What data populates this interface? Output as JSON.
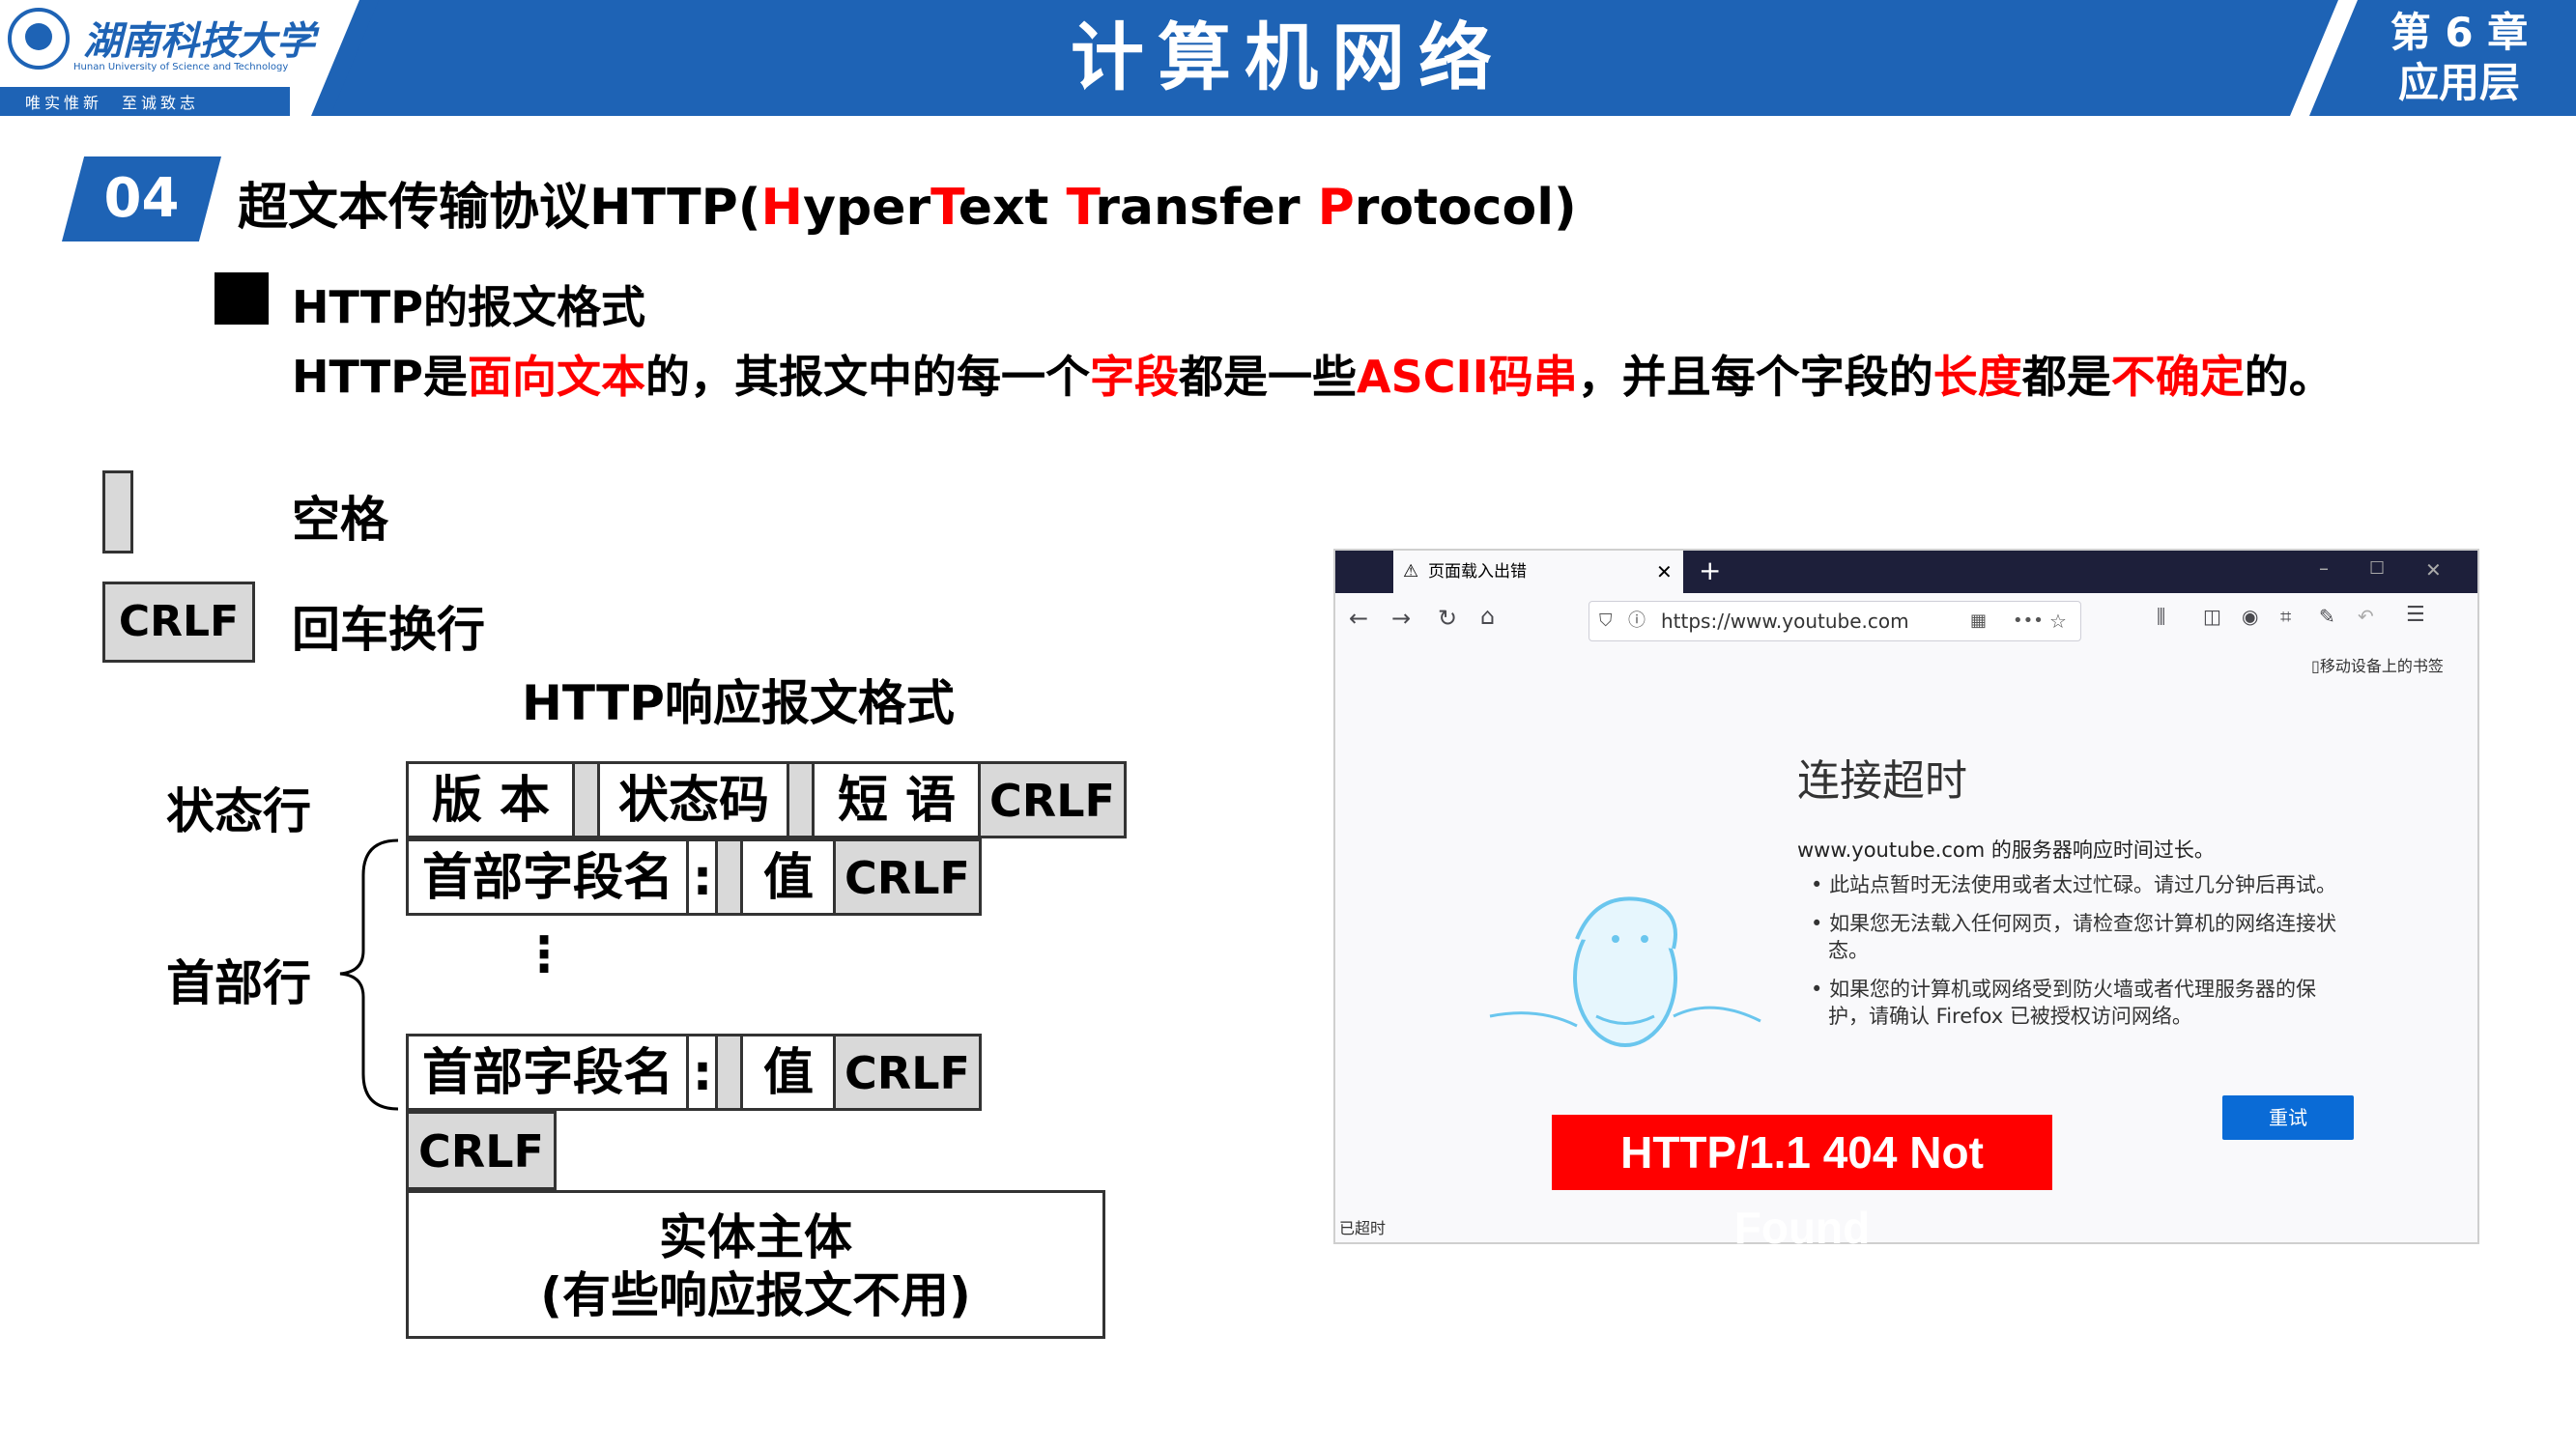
{
  "header": {
    "logo_cn": "湖南科技大学",
    "logo_en": "Hunan University of Science and Technology",
    "motto": "唯实惟新　至诚致志",
    "title": "计算机网络",
    "chapter_line1": "第 6 章",
    "chapter_line2": "应用层"
  },
  "section": {
    "number": "04",
    "title_cn": "超文本传输协议HTTP(",
    "title_en": [
      {
        "text": "H",
        "red": true
      },
      {
        "text": "yper",
        "red": false
      },
      {
        "text": "T",
        "red": true
      },
      {
        "text": "ext ",
        "red": false
      },
      {
        "text": "T",
        "red": true
      },
      {
        "text": "ransfer ",
        "red": false
      },
      {
        "text": "P",
        "red": true
      },
      {
        "text": "rotocol)",
        "red": false
      }
    ]
  },
  "subsection": {
    "title": "HTTP的报文格式",
    "description": [
      {
        "text": "HTTP是",
        "red": false
      },
      {
        "text": "面向文本",
        "red": true
      },
      {
        "text": "的，其报文中的每一个",
        "red": false
      },
      {
        "text": "字段",
        "red": true
      },
      {
        "text": "都是一些",
        "red": false
      },
      {
        "text": "ASCII码串",
        "red": true
      },
      {
        "text": "，并且每个字段的",
        "red": false
      },
      {
        "text": "长度",
        "red": true
      },
      {
        "text": "都是",
        "red": false
      },
      {
        "text": "不确定",
        "red": true
      },
      {
        "text": "的。",
        "red": false
      }
    ]
  },
  "legend": {
    "space_label": "空格",
    "crlf_box": "CRLF",
    "crlf_label": "回车换行"
  },
  "diagram": {
    "title": "HTTP响应报文格式",
    "status_line_label": "状态行",
    "header_line_label": "首部行",
    "version": "版 本",
    "status_code": "状态码",
    "phrase": "短 语",
    "crlf": "CRLF",
    "header_field_name": "首部字段名",
    "colon": ":",
    "value": "值",
    "vdots": "⋮",
    "entity_line1": "实体主体",
    "entity_line2": "(有些响应报文不用)"
  },
  "browser": {
    "tab_title": "页面载入出错",
    "url": "https://www.youtube.com",
    "bookmark_text": "移动设备上的书签",
    "error_title": "连接超时",
    "error_desc": "www.youtube.com 的服务器响应时间过长。",
    "error_items": [
      "此站点暂时无法使用或者太过忙碌。请过几分钟后再试。",
      "如果您无法载入任何网页，请检查您计算机的网络连接状态。",
      "如果您的计算机或网络受到防火墙或者代理服务器的保护，请确认 Firefox 已被授权访问网络。"
    ],
    "retry_button": "重试",
    "status_text": "已超时"
  },
  "overlay_label": "HTTP/1.1 404 Not Found"
}
